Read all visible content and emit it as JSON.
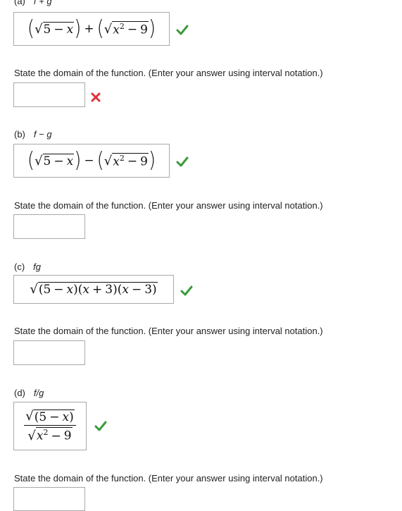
{
  "parts": [
    {
      "letter": "(a)",
      "function": "f + g",
      "expression_text": "(√(5 − x)) + (√(x² − 9))",
      "expression_status": "correct",
      "domain_prompt": "State the domain of the function. (Enter your answer using interval notation.)",
      "domain_value": "",
      "domain_status": "incorrect"
    },
    {
      "letter": "(b)",
      "function": "f − g",
      "expression_text": "(√(5 − x)) − (√(x² − 9))",
      "expression_status": "correct",
      "domain_prompt": "State the domain of the function. (Enter your answer using interval notation.)",
      "domain_value": ""
    },
    {
      "letter": "(c)",
      "function": "fg",
      "expression_text": "√((5 − x)(x + 3)(x − 3))",
      "expression_status": "correct",
      "domain_prompt": "State the domain of the function. (Enter your answer using interval notation.)",
      "domain_value": ""
    },
    {
      "letter": "(d)",
      "function": "f/g",
      "expression_text": "√(5 − x) / √(x² − 9)",
      "expression_status": "correct",
      "domain_prompt": "State the domain of the function. (Enter your answer using interval notation.)",
      "domain_value": ""
    }
  ],
  "math": {
    "five": "5",
    "nine": "9",
    "three": "3",
    "x": "x",
    "two": "2",
    "minus": "−",
    "plus": "+"
  },
  "colors": {
    "correct": "#3a9a3a",
    "incorrect": "#e0303a",
    "border": "#a9a9a9"
  },
  "icons": {
    "correct": "check-icon",
    "incorrect": "x-mark-icon"
  }
}
